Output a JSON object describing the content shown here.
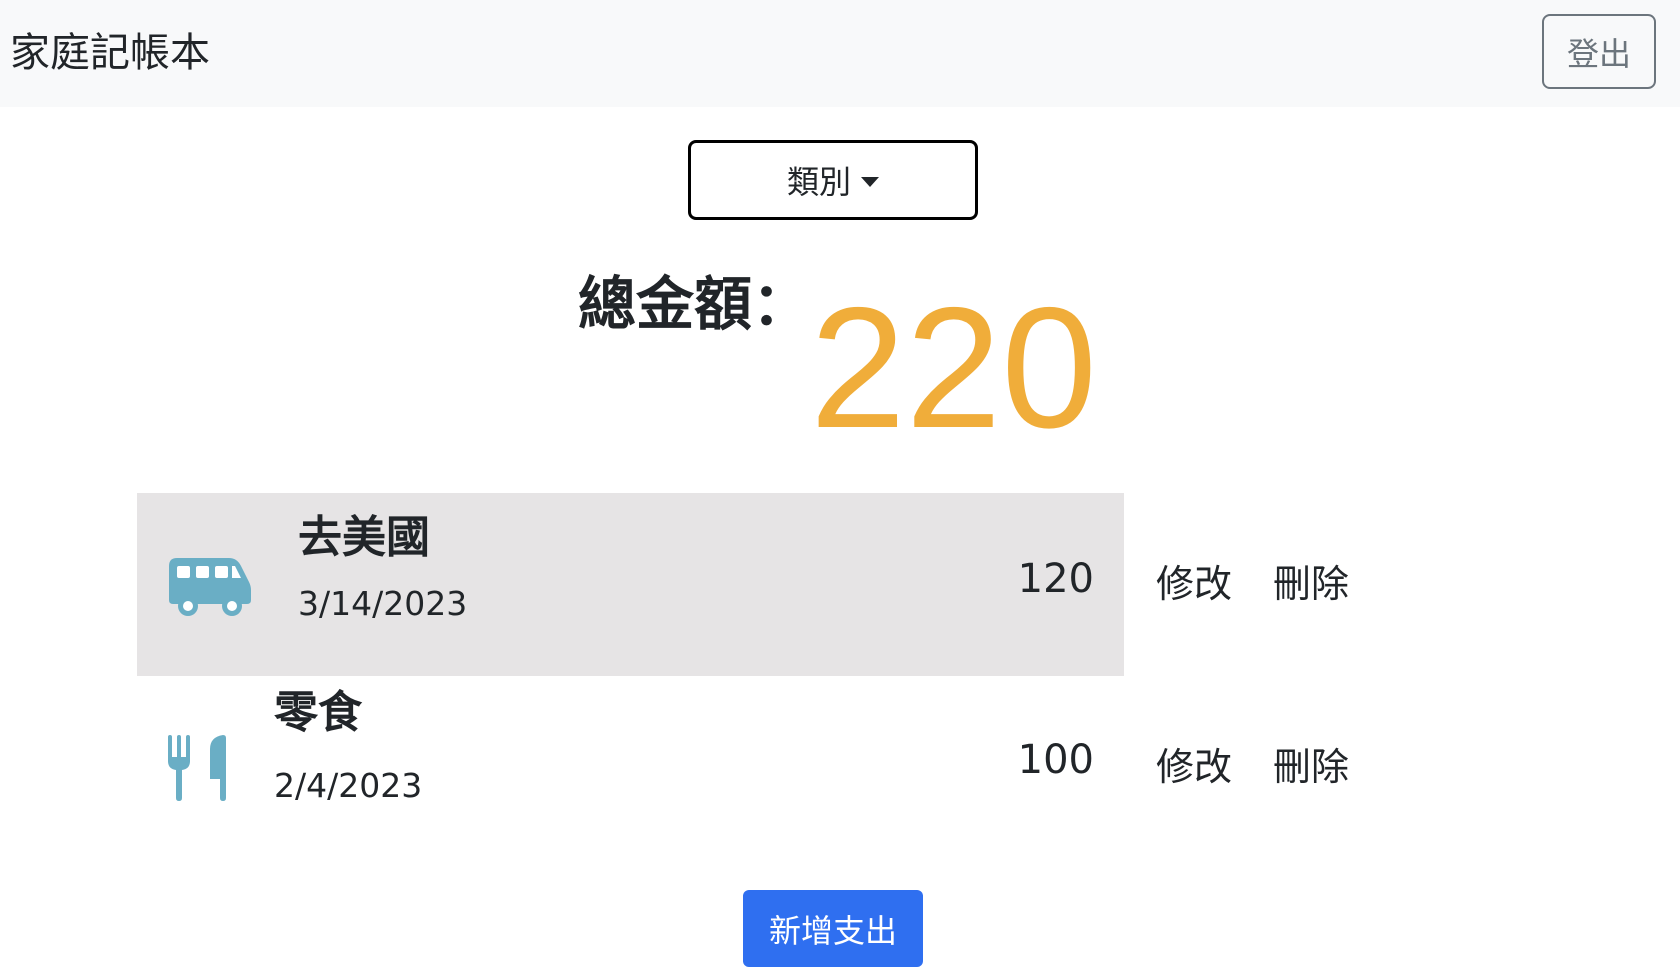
{
  "header": {
    "brand": "家庭記帳本",
    "logout_label": "登出"
  },
  "filter": {
    "category_label": "類別"
  },
  "summary": {
    "total_label": "總金額：",
    "total_value": "220"
  },
  "expenses": [
    {
      "icon": "bus-icon",
      "title": "去美國",
      "date": "3/14/2023",
      "amount": "120",
      "edit_label": "修改",
      "delete_label": "刪除"
    },
    {
      "icon": "utensils-icon",
      "title": "零食",
      "date": "2/4/2023",
      "amount": "100",
      "edit_label": "修改",
      "delete_label": "刪除"
    }
  ],
  "actions": {
    "add_label": "新增支出"
  },
  "colors": {
    "total": "#f0ad3a",
    "icon": "#6aaec5",
    "highlight_row": "#e6e4e5",
    "primary_button": "#2f6ff0"
  }
}
